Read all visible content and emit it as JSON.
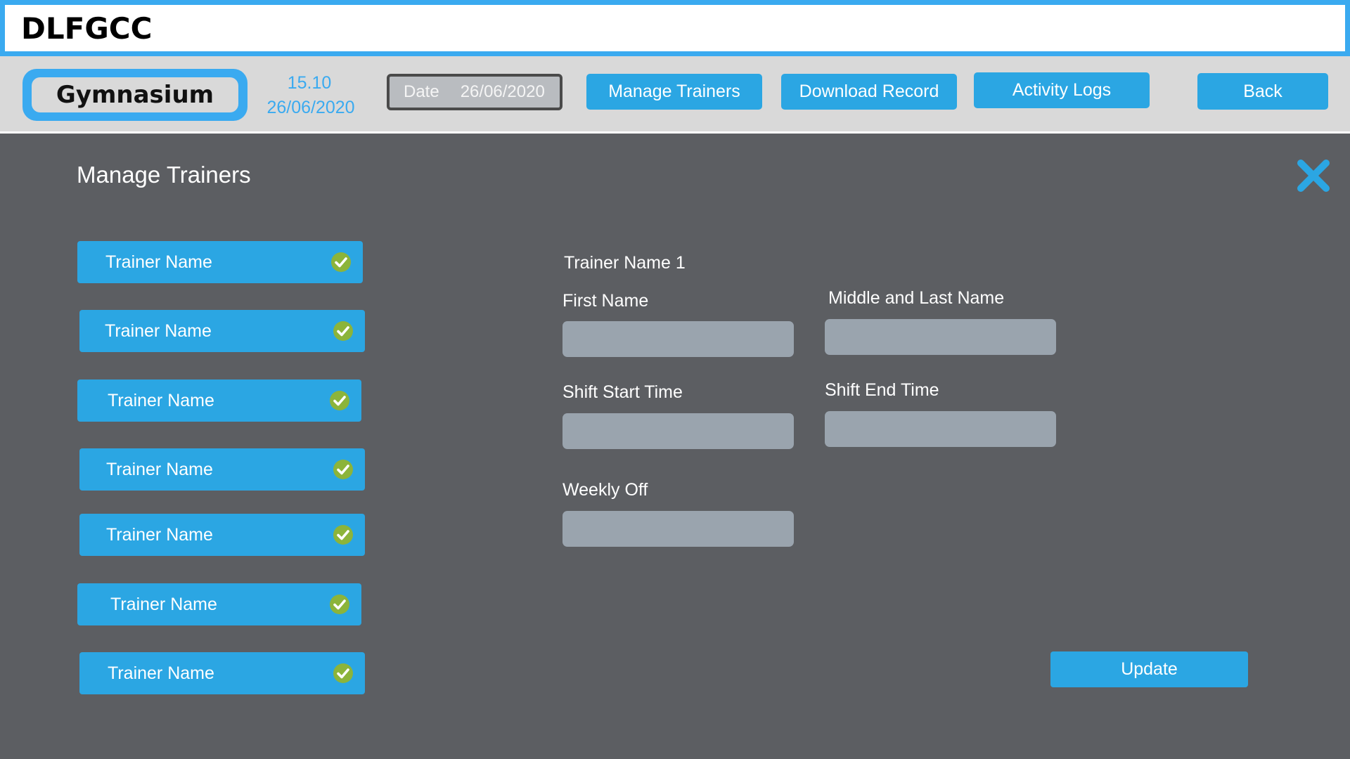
{
  "app": {
    "title": "DLFGCC"
  },
  "header": {
    "facility": "Gymnasium",
    "time": "15.10",
    "date": "26/06/2020",
    "date_field": {
      "label": "Date",
      "value": "26/06/2020"
    },
    "buttons": {
      "manage_trainers": "Manage Trainers",
      "download_record": "Download Record",
      "activity_logs": "Activity Logs",
      "back": "Back"
    }
  },
  "panel": {
    "title": "Manage Trainers",
    "close_icon": "close-icon",
    "trainers": [
      {
        "label": "Trainer Name",
        "status": "check-icon"
      },
      {
        "label": "Trainer Name",
        "status": "check-icon"
      },
      {
        "label": "Trainer Name",
        "status": "check-icon"
      },
      {
        "label": "Trainer Name",
        "status": "check-icon"
      },
      {
        "label": "Trainer Name",
        "status": "check-icon"
      },
      {
        "label": "Trainer Name",
        "status": "check-icon"
      },
      {
        "label": "Trainer Name",
        "status": "check-icon"
      }
    ],
    "detail": {
      "heading": "Trainer Name 1",
      "first_name": {
        "label": "First Name",
        "value": ""
      },
      "middle_last_name": {
        "label": "Middle and Last Name",
        "value": ""
      },
      "shift_start": {
        "label": "Shift Start Time",
        "value": ""
      },
      "shift_end": {
        "label": "Shift End Time",
        "value": ""
      },
      "weekly_off": {
        "label": "Weekly Off",
        "value": ""
      }
    },
    "update_label": "Update"
  },
  "colors": {
    "accent": "#2ba6e3",
    "title_border": "#3aaaf0",
    "background": "#5c5e62",
    "header_bg": "#d9d9d9",
    "input_bg": "#9aa4ae",
    "check_green": "#8cb43a"
  }
}
